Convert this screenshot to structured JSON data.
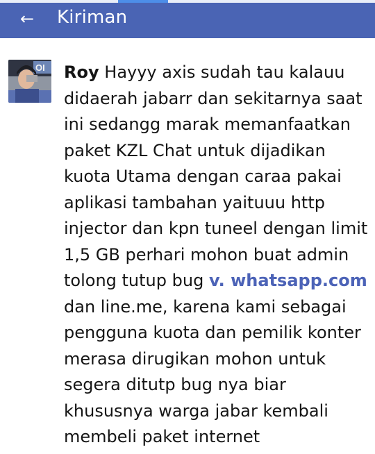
{
  "header": {
    "back_icon": "←",
    "title": "Kiriman"
  },
  "post": {
    "author": "Roy",
    "text_before_link": "Hayyy axis sudah tau kalauu didaerah jabarr dan sekitarnya saat ini sedangg marak memanfaatkan paket KZL Chat untuk dijadikan kuota Utama dengan caraa pakai aplikasi tambahan yaituuu http injector dan kpn tuneel dengan limit 1,5 GB perhari mohon buat admin tolong tutup bug",
    "link_text": "v. whatsapp.com",
    "text_after_link": "dan line.me,  karena kami sebagai pengguna kuota dan pemilik konter merasa dirugikan mohon untuk segera ditutp bug nya biar khususnya warga jabar kembali membeli paket internet"
  },
  "colors": {
    "appbar": "#4a64b4",
    "link": "#4c63b7",
    "text": "#151515"
  }
}
